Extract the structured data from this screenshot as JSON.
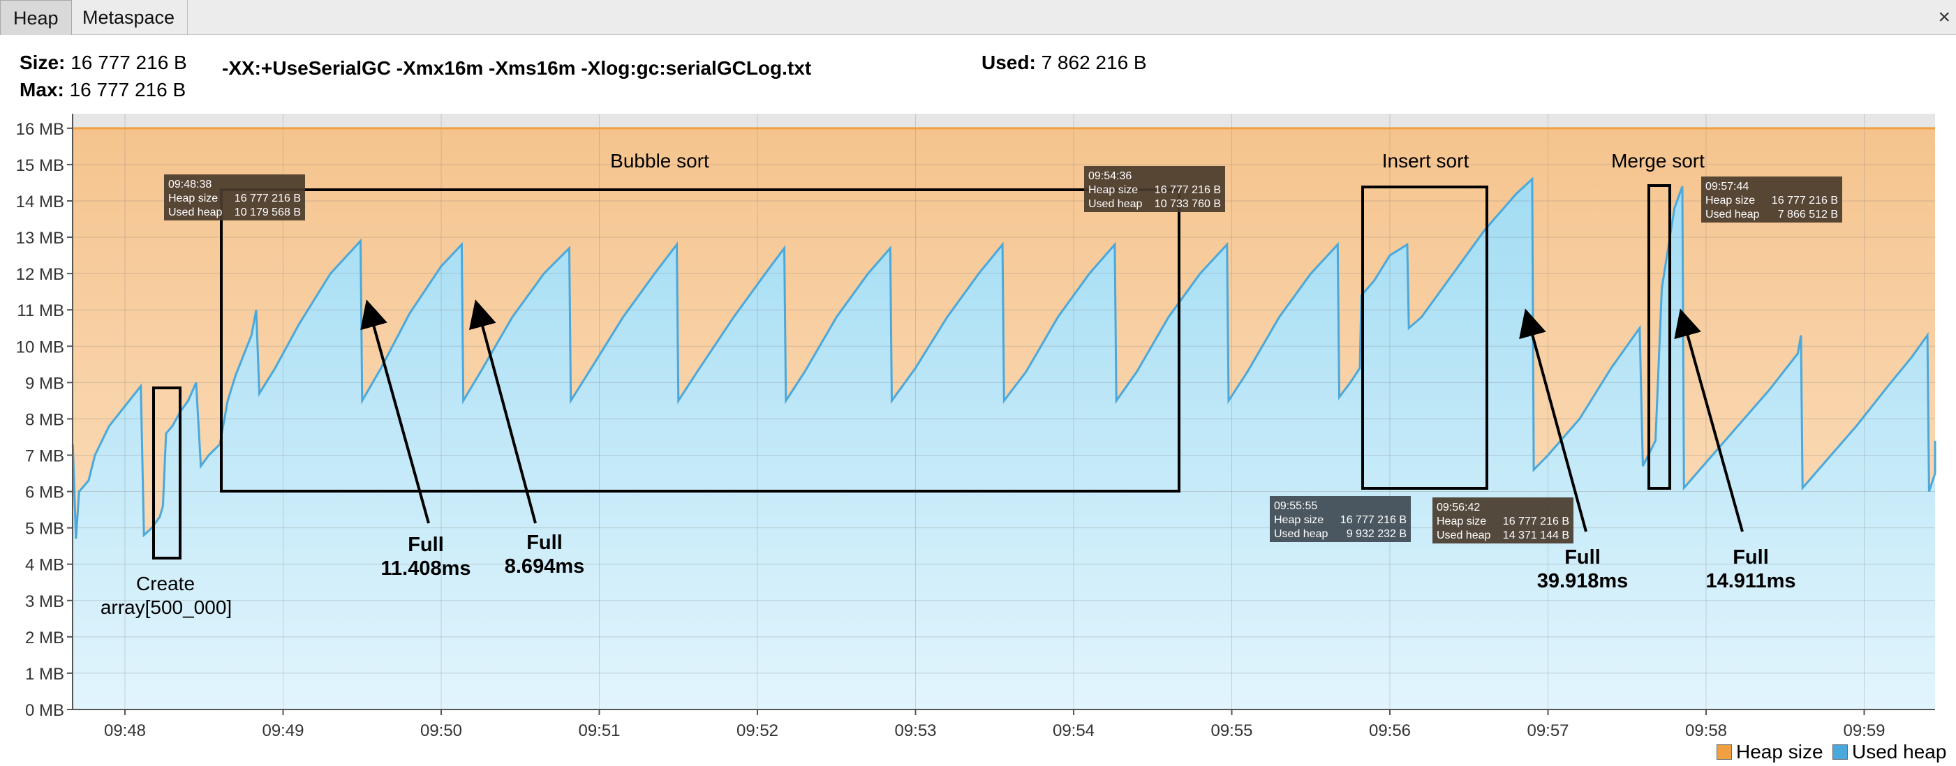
{
  "tabs": [
    {
      "label": "Heap",
      "active": true
    },
    {
      "label": "Metaspace",
      "active": false
    }
  ],
  "close_icon": "×",
  "info": {
    "size_label": "Size:",
    "size_value": "16 777 216 B",
    "max_label": "Max:",
    "max_value": "16 777 216 B",
    "command": "-XX:+UseSerialGC -Xmx16m -Xms16m -Xlog:gc:serialGCLog.txt",
    "used_label": "Used:",
    "used_value": "7 862 216 B"
  },
  "legend": [
    {
      "label": "Heap size",
      "color": "#f0a040"
    },
    {
      "label": "Used heap",
      "color": "#4aa8dc"
    }
  ],
  "chart_data": {
    "type": "area",
    "ylabel_ticks": [
      "0 MB",
      "1 MB",
      "2 MB",
      "3 MB",
      "4 MB",
      "5 MB",
      "6 MB",
      "7 MB",
      "8 MB",
      "9 MB",
      "10 MB",
      "11 MB",
      "12 MB",
      "13 MB",
      "14 MB",
      "15 MB",
      "16 MB"
    ],
    "x_ticks": [
      "09:48",
      "09:49",
      "09:50",
      "09:51",
      "09:52",
      "09:53",
      "09:54",
      "09:55",
      "09:56",
      "09:57",
      "09:58",
      "09:59"
    ],
    "ylim": [
      0,
      16.4
    ],
    "heap_size_mb": 16,
    "series": [
      {
        "name": "Heap size",
        "color": "#f0a040",
        "values_mb": [
          [
            -0.33,
            16
          ],
          [
            11.6,
            16
          ]
        ]
      },
      {
        "name": "Used heap",
        "color": "#4aa8dc",
        "values_mb": [
          [
            -0.33,
            7.3
          ],
          [
            -0.31,
            4.7
          ],
          [
            -0.29,
            6.0
          ],
          [
            -0.23,
            6.3
          ],
          [
            -0.19,
            7.0
          ],
          [
            -0.1,
            7.8
          ],
          [
            0.1,
            8.9
          ],
          [
            0.12,
            4.8
          ],
          [
            0.17,
            5.0
          ],
          [
            0.22,
            5.3
          ],
          [
            0.24,
            5.6
          ],
          [
            0.26,
            7.6
          ],
          [
            0.3,
            7.8
          ],
          [
            0.35,
            8.2
          ],
          [
            0.4,
            8.5
          ],
          [
            0.45,
            9.0
          ],
          [
            0.48,
            6.7
          ],
          [
            0.53,
            7.0
          ],
          [
            0.6,
            7.3
          ],
          [
            0.65,
            8.5
          ],
          [
            0.7,
            9.2
          ],
          [
            0.8,
            10.3
          ],
          [
            0.83,
            11.0
          ],
          [
            0.85,
            8.7
          ],
          [
            0.95,
            9.4
          ],
          [
            1.1,
            10.6
          ],
          [
            1.3,
            12.0
          ],
          [
            1.49,
            12.9
          ],
          [
            1.5,
            8.5
          ],
          [
            1.62,
            9.4
          ],
          [
            1.8,
            10.9
          ],
          [
            2.0,
            12.2
          ],
          [
            2.13,
            12.8
          ],
          [
            2.14,
            8.5
          ],
          [
            2.25,
            9.3
          ],
          [
            2.45,
            10.8
          ],
          [
            2.65,
            12.0
          ],
          [
            2.81,
            12.7
          ],
          [
            2.82,
            8.5
          ],
          [
            2.95,
            9.4
          ],
          [
            3.15,
            10.8
          ],
          [
            3.35,
            12.0
          ],
          [
            3.49,
            12.8
          ],
          [
            3.5,
            8.5
          ],
          [
            3.62,
            9.3
          ],
          [
            3.85,
            10.8
          ],
          [
            4.05,
            12.0
          ],
          [
            4.17,
            12.7
          ],
          [
            4.18,
            8.5
          ],
          [
            4.3,
            9.3
          ],
          [
            4.5,
            10.8
          ],
          [
            4.7,
            12.0
          ],
          [
            4.84,
            12.7
          ],
          [
            4.85,
            8.5
          ],
          [
            5.0,
            9.4
          ],
          [
            5.2,
            10.8
          ],
          [
            5.4,
            12.0
          ],
          [
            5.55,
            12.8
          ],
          [
            5.56,
            8.5
          ],
          [
            5.7,
            9.3
          ],
          [
            5.9,
            10.8
          ],
          [
            6.1,
            12.0
          ],
          [
            6.26,
            12.8
          ],
          [
            6.27,
            8.5
          ],
          [
            6.4,
            9.3
          ],
          [
            6.6,
            10.8
          ],
          [
            6.8,
            12.0
          ],
          [
            6.97,
            12.8
          ],
          [
            6.98,
            8.5
          ],
          [
            7.1,
            9.3
          ],
          [
            7.3,
            10.8
          ],
          [
            7.5,
            12.0
          ],
          [
            7.67,
            12.8
          ],
          [
            7.68,
            8.6
          ],
          [
            7.75,
            9.0
          ],
          [
            7.81,
            9.4
          ],
          [
            7.82,
            11.4
          ],
          [
            7.9,
            11.8
          ],
          [
            8.0,
            12.5
          ],
          [
            8.11,
            12.8
          ],
          [
            8.12,
            10.5
          ],
          [
            8.2,
            10.8
          ],
          [
            8.4,
            12.0
          ],
          [
            8.6,
            13.2
          ],
          [
            8.8,
            14.2
          ],
          [
            8.9,
            14.6
          ],
          [
            8.91,
            6.6
          ],
          [
            9.0,
            7.0
          ],
          [
            9.2,
            8.0
          ],
          [
            9.4,
            9.4
          ],
          [
            9.58,
            10.5
          ],
          [
            9.6,
            6.7
          ],
          [
            9.68,
            7.4
          ],
          [
            9.72,
            11.6
          ],
          [
            9.8,
            13.8
          ],
          [
            9.85,
            14.4
          ],
          [
            9.86,
            6.1
          ],
          [
            10.0,
            6.8
          ],
          [
            10.2,
            7.8
          ],
          [
            10.4,
            8.8
          ],
          [
            10.58,
            9.8
          ],
          [
            10.6,
            10.3
          ],
          [
            10.61,
            6.1
          ],
          [
            10.75,
            6.8
          ],
          [
            10.95,
            7.8
          ],
          [
            11.15,
            8.9
          ],
          [
            11.3,
            9.7
          ],
          [
            11.4,
            10.3
          ],
          [
            11.41,
            6.0
          ],
          [
            11.5,
            6.5
          ],
          [
            11.6,
            7.4
          ]
        ]
      }
    ],
    "annotations": {
      "regions": [
        "Bubble sort",
        "Insert sort",
        "Merge sort"
      ],
      "create_label": [
        "Create",
        "array[500_000]"
      ],
      "full_gc": [
        {
          "label": "Full",
          "time": "11.408ms"
        },
        {
          "label": "Full",
          "time": "8.694ms"
        },
        {
          "label": "Full",
          "time": "39.918ms"
        },
        {
          "label": "Full",
          "time": "14.911ms"
        }
      ],
      "tooltips": [
        {
          "time": "09:48:38",
          "heap_label": "Heap size",
          "heap": "16 777 216 B",
          "used_label": "Used heap",
          "used": "10 179 568 B"
        },
        {
          "time": "09:54:36",
          "heap_label": "Heap size",
          "heap": "16 777 216 B",
          "used_label": "Used heap",
          "used": "10 733 760 B"
        },
        {
          "time": "09:57:44",
          "heap_label": "Heap size",
          "heap": "16 777 216 B",
          "used_label": "Used heap",
          "used": "7 866 512 B"
        },
        {
          "time": "09:55:55",
          "heap_label": "Heap size",
          "heap": "16 777 216 B",
          "used_label": "Used heap",
          "used": "9 932 232 B"
        },
        {
          "time": "09:56:42",
          "heap_label": "Heap size",
          "heap": "16 777 216 B",
          "used_label": "Used heap",
          "used": "14 371 144 B"
        }
      ]
    }
  }
}
